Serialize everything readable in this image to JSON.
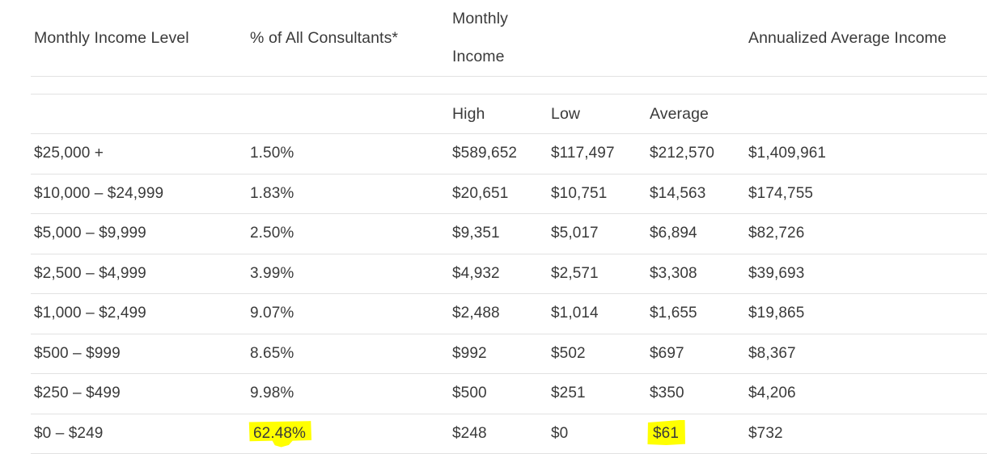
{
  "table": {
    "headers_primary": [
      "Monthly Income Level",
      "% of All Consultants*",
      "Monthly Income",
      "",
      "",
      "Annualized Average Income"
    ],
    "headers_secondary": [
      "",
      "",
      "High",
      "Low",
      "Average",
      ""
    ],
    "rows": [
      {
        "level": "$25,000 +",
        "pct": "1.50%",
        "high": "$589,652",
        "low": "$117,497",
        "average": "$212,570",
        "annualized": "$1,409,961"
      },
      {
        "level": "$10,000 – $24,999",
        "pct": "1.83%",
        "high": "$20,651",
        "low": "$10,751",
        "average": "$14,563",
        "annualized": "$174,755"
      },
      {
        "level": "$5,000 – $9,999",
        "pct": "2.50%",
        "high": "$9,351",
        "low": "$5,017",
        "average": "$6,894",
        "annualized": "$82,726"
      },
      {
        "level": "$2,500 – $4,999",
        "pct": "3.99%",
        "high": "$4,932",
        "low": "$2,571",
        "average": "$3,308",
        "annualized": "$39,693"
      },
      {
        "level": "$1,000 – $2,499",
        "pct": "9.07%",
        "high": "$2,488",
        "low": "$1,014",
        "average": "$1,655",
        "annualized": "$19,865"
      },
      {
        "level": "$500 – $999",
        "pct": "8.65%",
        "high": "$992",
        "low": "$502",
        "average": "$697",
        "annualized": "$8,367"
      },
      {
        "level": "$250 – $499",
        "pct": "9.98%",
        "high": "$500",
        "low": "$251",
        "average": "$350",
        "annualized": "$4,206"
      },
      {
        "level": "$0 – $249",
        "pct": "62.48%",
        "high": "$248",
        "low": "$0",
        "average": "$61",
        "annualized": "$732"
      }
    ],
    "highlight_color": "#ffff00",
    "border_color": "#e2e2e2",
    "text_color": "#3a3a3a"
  }
}
